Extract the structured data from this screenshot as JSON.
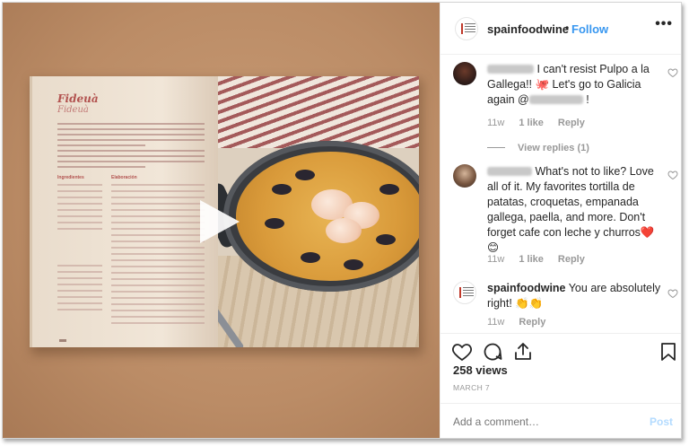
{
  "post": {
    "account": "spainfoodwine",
    "separator": "•",
    "follow_label": "Follow",
    "more_label": "•••"
  },
  "media": {
    "book_title": "Fideuà",
    "book_subtitle": "Fideuà",
    "ingredients_heading": "Ingredientes",
    "preparation_heading": "Elaboración",
    "play_icon": "play-icon"
  },
  "comments": [
    {
      "text_a": "I can't resist Pulpo a la Gallega!! 🐙 Let's go to Galicia again @",
      "text_b": " !",
      "time": "11w",
      "likes": "1 like",
      "reply": "Reply",
      "view_replies": "View replies (1)"
    },
    {
      "text": "What's not to like? Love all of it. My favorites tortilla de patatas, croquetas, empanada gallega, paella, and more. Don't forget cafe con leche y churros❤️😊",
      "time": "11w",
      "likes": "1 like",
      "reply": "Reply"
    },
    {
      "user": "spainfoodwine",
      "text": " You are absolutely right! 👏👏",
      "time": "11w",
      "reply": "Reply"
    }
  ],
  "stats": {
    "views": "258 views",
    "date": "MARCH 7"
  },
  "composer": {
    "placeholder": "Add a comment…",
    "post_label": "Post"
  },
  "colors": {
    "link": "#3897f0",
    "muted": "#999999",
    "post_disabled": "#b3dbff"
  }
}
